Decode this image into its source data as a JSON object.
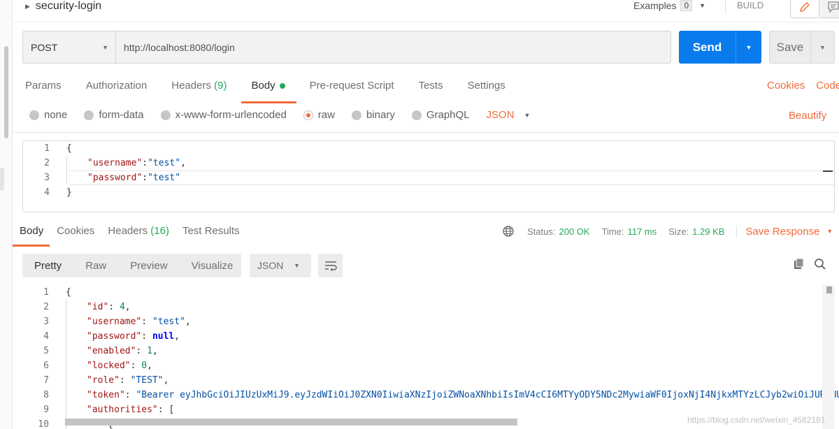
{
  "request": {
    "name": "security-login",
    "examples_label": "Examples",
    "examples_count": "0",
    "build_label": "BUILD",
    "method": "POST",
    "url": "http://localhost:8080/login",
    "send_label": "Send",
    "save_label": "Save"
  },
  "request_tabs": {
    "params": "Params",
    "authorization": "Authorization",
    "headers": "Headers",
    "headers_count": "(9)",
    "body": "Body",
    "pre_request": "Pre-request Script",
    "tests": "Tests",
    "settings": "Settings",
    "cookies": "Cookies",
    "code": "Code"
  },
  "body_types": {
    "none": "none",
    "form_data": "form-data",
    "urlencoded": "x-www-form-urlencoded",
    "raw": "raw",
    "binary": "binary",
    "graphql": "GraphQL",
    "format": "JSON",
    "beautify": "Beautify",
    "selected": "raw"
  },
  "request_body": {
    "line_numbers": [
      "1",
      "2",
      "3",
      "4"
    ],
    "open": "{",
    "close": "}",
    "k1": "\"username\"",
    "v1": "\"test\"",
    "k2": "\"password\"",
    "v2": "\"test\""
  },
  "response_tabs": {
    "body": "Body",
    "cookies": "Cookies",
    "headers": "Headers",
    "headers_count": "(16)",
    "test_results": "Test Results"
  },
  "response_status": {
    "status_label": "Status:",
    "status_value": "200 OK",
    "time_label": "Time:",
    "time_value": "117 ms",
    "size_label": "Size:",
    "size_value": "1.29 KB",
    "save_response": "Save Response"
  },
  "response_view": {
    "pretty": "Pretty",
    "raw": "Raw",
    "preview": "Preview",
    "visualize": "Visualize",
    "format": "JSON"
  },
  "response_body": {
    "line_numbers": [
      "1",
      "2",
      "3",
      "4",
      "5",
      "6",
      "7",
      "8",
      "9",
      "10"
    ],
    "open": "{",
    "id_key": "\"id\"",
    "id_val": "4",
    "username_key": "\"username\"",
    "username_val": "\"test\"",
    "password_key": "\"password\"",
    "password_val": "null",
    "enabled_key": "\"enabled\"",
    "enabled_val": "1",
    "locked_key": "\"locked\"",
    "locked_val": "0",
    "role_key": "\"role\"",
    "role_val": "\"TEST\"",
    "token_key": "\"token\"",
    "token_val": "\"Bearer eyJhbGciOiJIUzUxMiJ9.eyJzdWIiOiJ0ZXN0IiwiaXNzIjoiZWNoaXNhbiIsImV4cCI6MTYyODY5NDc2MywiaWF0IjoxNjI4NjkxMTYzLCJyb2wiOiJURVNUI",
    "authorities_key": "\"authorities\"",
    "authorities_val": "[",
    "line10": "{"
  },
  "watermark": "https://blog.csdn.net/weixin_4582181",
  "colors": {
    "accent_orange": "#f26b3a",
    "send_blue": "#097bed",
    "status_green": "#26a75a",
    "json_key": "#a31515",
    "json_string": "#0451a5",
    "json_number": "#098658"
  }
}
